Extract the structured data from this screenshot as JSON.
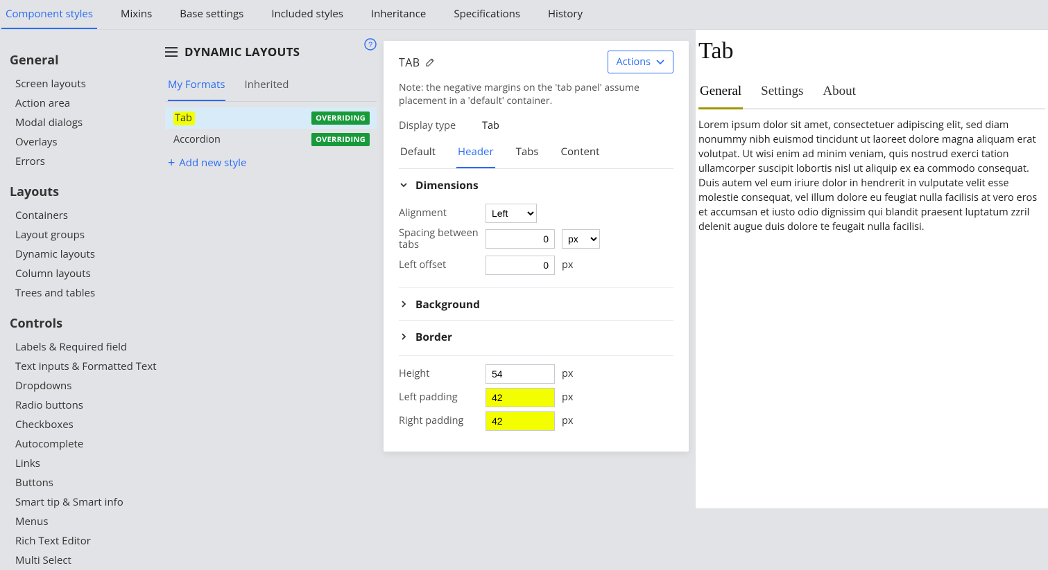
{
  "topTabs": [
    "Component styles",
    "Mixins",
    "Base settings",
    "Included styles",
    "Inheritance",
    "Specifications",
    "History"
  ],
  "topTabActive": 0,
  "nav": [
    {
      "title": "General",
      "items": [
        "Screen layouts",
        "Action area",
        "Modal dialogs",
        "Overlays",
        "Errors"
      ]
    },
    {
      "title": "Layouts",
      "items": [
        "Containers",
        "Layout groups",
        "Dynamic layouts",
        "Column layouts",
        "Trees and tables"
      ]
    },
    {
      "title": "Controls",
      "items": [
        "Labels & Required field",
        "Text inputs & Formatted Text",
        "Dropdowns",
        "Radio buttons",
        "Checkboxes",
        "Autocomplete",
        "Links",
        "Buttons",
        "Smart tip & Smart info",
        "Menus",
        "Rich Text Editor",
        "Multi Select"
      ]
    }
  ],
  "mid": {
    "title": "DYNAMIC LAYOUTS",
    "subTabs": [
      "My Formats",
      "Inherited"
    ],
    "subTabActive": 0,
    "items": [
      {
        "name": "Tab",
        "badge": "OVERRIDING",
        "selected": true,
        "highlight": true
      },
      {
        "name": "Accordion",
        "badge": "OVERRIDING",
        "selected": false,
        "highlight": false
      }
    ],
    "addNew": "Add new style"
  },
  "panel": {
    "title": "TAB",
    "actions": "Actions",
    "note": "Note: the negative margins on the 'tab panel' assume placement in a 'default' container.",
    "displayTypeLabel": "Display type",
    "displayTypeValue": "Tab",
    "tabs": [
      "Default",
      "Header",
      "Tabs",
      "Content"
    ],
    "tabActive": 1,
    "sections": {
      "dimensions": {
        "title": "Dimensions",
        "open": true,
        "alignmentLabel": "Alignment",
        "alignmentValue": "Left",
        "spacingLabel": "Spacing between tabs",
        "spacingValue": "0",
        "spacingUnit": "px",
        "leftOffsetLabel": "Left offset",
        "leftOffsetValue": "0",
        "leftOffsetUnit": "px"
      },
      "background": {
        "title": "Background",
        "open": false
      },
      "border": {
        "title": "Border",
        "open": false
      }
    },
    "metrics": {
      "heightLabel": "Height",
      "heightValue": "54",
      "heightUnit": "px",
      "leftPadLabel": "Left padding",
      "leftPadValue": "42",
      "leftPadUnit": "px",
      "rightPadLabel": "Right padding",
      "rightPadValue": "42",
      "rightPadUnit": "px"
    }
  },
  "preview": {
    "title": "Tab",
    "tabs": [
      "General",
      "Settings",
      "About"
    ],
    "tabActive": 0,
    "body": "Lorem ipsum dolor sit amet, consectetuer adipiscing elit, sed diam nonummy nibh euismod tincidunt ut laoreet dolore magna aliquam erat volutpat. Ut wisi enim ad minim veniam, quis nostrud exerci tation ullamcorper suscipit lobortis nisl ut aliquip ex ea commodo consequat. Duis autem vel eum iriure dolor in hendrerit in vulputate velit esse molestie consequat, vel illum dolore eu feugiat nulla facilisis at vero eros et accumsan et iusto odio dignissim qui blandit praesent luptatum zzril delenit augue duis dolore te feugait nulla facilisi."
  }
}
